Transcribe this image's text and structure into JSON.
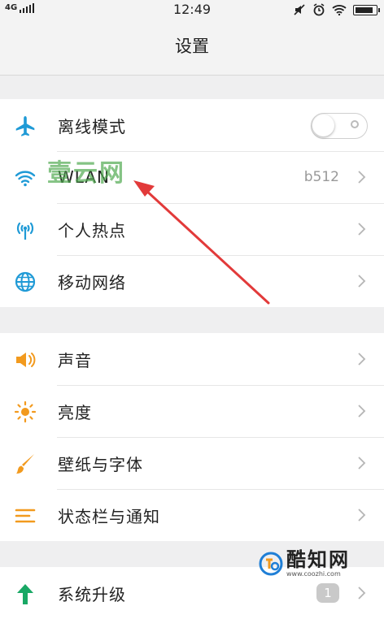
{
  "status_bar": {
    "network": "4G",
    "time": "12:49",
    "battery_level": 0.9
  },
  "title": "设置",
  "groups": [
    {
      "items": [
        {
          "label": "离线模式",
          "icon": "airplane-icon",
          "type": "toggle",
          "enabled": false
        },
        {
          "label": "WLAN",
          "icon": "wifi-icon",
          "type": "nav",
          "value": "b512"
        },
        {
          "label": "个人热点",
          "icon": "hotspot-icon",
          "type": "nav"
        },
        {
          "label": "移动网络",
          "icon": "globe-icon",
          "type": "nav"
        }
      ]
    },
    {
      "items": [
        {
          "label": "声音",
          "icon": "speaker-icon",
          "type": "nav"
        },
        {
          "label": "亮度",
          "icon": "brightness-icon",
          "type": "nav"
        },
        {
          "label": "壁纸与字体",
          "icon": "brush-icon",
          "type": "nav"
        },
        {
          "label": "状态栏与通知",
          "icon": "menu-lines-icon",
          "type": "nav"
        }
      ]
    },
    {
      "items": [
        {
          "label": "系统升级",
          "icon": "upgrade-arrow-icon",
          "type": "nav",
          "badge": "1"
        }
      ]
    }
  ],
  "watermarks": {
    "top": "壹云网",
    "bottom_title": "酷知网",
    "bottom_url": "www.coozhi.com"
  },
  "colors": {
    "blue_icon": "#1f9ad6",
    "orange_icon": "#f29a1e",
    "green_icon": "#19a865",
    "annotation_arrow": "#e23a3a"
  }
}
